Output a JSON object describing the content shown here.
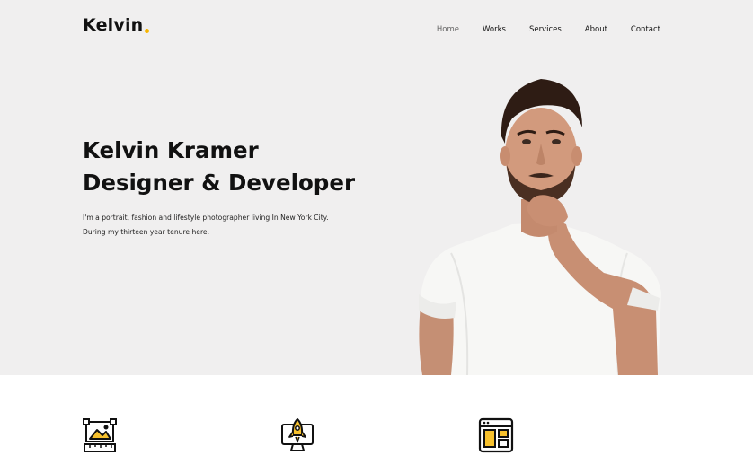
{
  "brand": {
    "name": "Kelvin",
    "dot_color": "#f7b500"
  },
  "nav": {
    "items": [
      {
        "label": "Home",
        "active": true
      },
      {
        "label": "Works",
        "active": false
      },
      {
        "label": "Services",
        "active": false
      },
      {
        "label": "About",
        "active": false
      },
      {
        "label": "Contact",
        "active": false
      }
    ]
  },
  "hero": {
    "name_line": "Kelvin Kramer",
    "role_line": "Designer & Developer",
    "desc_line1": "I'm a portrait, fashion and lifestyle photographer living In New York City.",
    "desc_line2": "During my thirteen year tenure here.",
    "background": "#f0efef"
  },
  "services": {
    "icons": [
      "image-editing-icon",
      "rocket-monitor-icon",
      "web-layout-icon"
    ],
    "accent": "#f7c12d"
  }
}
